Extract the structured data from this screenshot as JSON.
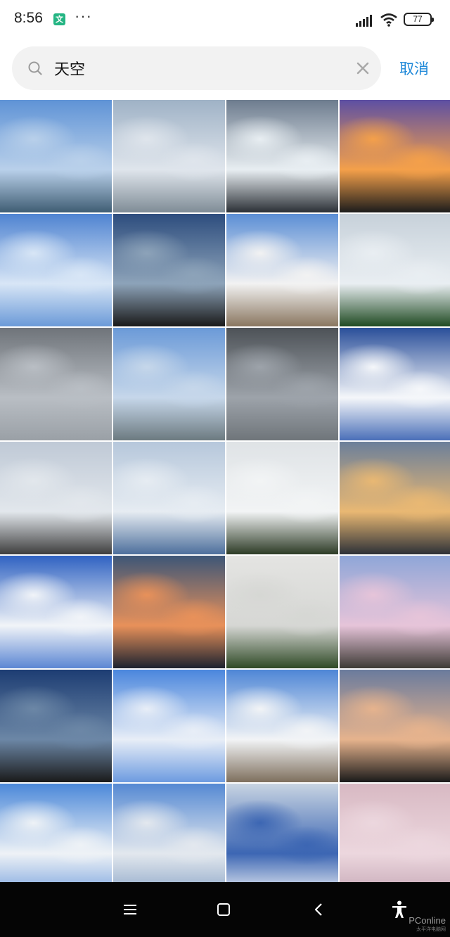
{
  "status_bar": {
    "time": "8:56",
    "app_icon": "tencent-news-icon",
    "more": "···",
    "battery": "77"
  },
  "search": {
    "query": "天空",
    "placeholder": "",
    "cancel_label": "取消"
  },
  "photos": [
    {
      "name": "photo-sky-city-blue",
      "colors": [
        "#5f93d6",
        "#b9d0ea",
        "#3f5d73"
      ]
    },
    {
      "name": "photo-grey-clouds",
      "colors": [
        "#9fb2c6",
        "#dfe5ec",
        "#7f8c96"
      ]
    },
    {
      "name": "photo-sun-through-clouds",
      "colors": [
        "#6d7c8e",
        "#e8eef2",
        "#2b3036"
      ]
    },
    {
      "name": "photo-sunset-purple",
      "colors": [
        "#5d4fa3",
        "#f4a04a",
        "#1c1c1c"
      ]
    },
    {
      "name": "photo-blue-sky-white-clouds",
      "colors": [
        "#4f83d1",
        "#d8e6f6",
        "#6b9ad8"
      ]
    },
    {
      "name": "photo-dark-river-screenshot",
      "colors": [
        "#2d4d7e",
        "#8da3b9",
        "#1a1a1a"
      ]
    },
    {
      "name": "photo-bridge-blue-sky",
      "colors": [
        "#5b8ed5",
        "#f2f2f2",
        "#8a7760"
      ]
    },
    {
      "name": "photo-palm-tree",
      "colors": [
        "#c7d1da",
        "#e9eef2",
        "#1f4a22"
      ]
    },
    {
      "name": "photo-overcast",
      "colors": [
        "#6f747a",
        "#b9bec4",
        "#9aa0a6"
      ]
    },
    {
      "name": "photo-river-horizon",
      "colors": [
        "#6b9ad8",
        "#c6d7ea",
        "#6c7a80"
      ]
    },
    {
      "name": "photo-storm-clouds-river",
      "colors": [
        "#4d5257",
        "#9da3aa",
        "#6f757a"
      ]
    },
    {
      "name": "photo-cumulus-dark-blue",
      "colors": [
        "#2a4f9a",
        "#f5f7fa",
        "#4a6fb8"
      ]
    },
    {
      "name": "photo-road-clouds",
      "colors": [
        "#bfc9d6",
        "#e2e7ec",
        "#3e3e3e"
      ]
    },
    {
      "name": "photo-wispy-clouds",
      "colors": [
        "#b6c7db",
        "#e6ecf2",
        "#4d6f9c"
      ]
    },
    {
      "name": "photo-tree-building-sky",
      "colors": [
        "#dfe3e6",
        "#f2f4f5",
        "#2d3b26"
      ]
    },
    {
      "name": "photo-golden-river-evening",
      "colors": [
        "#6b7f9a",
        "#e9b873",
        "#2d3138"
      ]
    },
    {
      "name": "photo-deep-blue-clouds",
      "colors": [
        "#2f62c2",
        "#f1f4f8",
        "#5b86d3"
      ]
    },
    {
      "name": "photo-sunset-orange-clouds",
      "colors": [
        "#3d5677",
        "#e8915a",
        "#1b2230"
      ]
    },
    {
      "name": "photo-white-sky-trees",
      "colors": [
        "#e4e4e2",
        "#d6d7d4",
        "#2f4a26"
      ]
    },
    {
      "name": "photo-buildings-pink-sky",
      "colors": [
        "#8fa6d8",
        "#e6c4d9",
        "#3d3a35"
      ]
    },
    {
      "name": "photo-dark-river-screenshot-2",
      "colors": [
        "#1d3d73",
        "#6c87a6",
        "#1a1a1a"
      ]
    },
    {
      "name": "photo-blue-sky-clouds-2",
      "colors": [
        "#4a86dd",
        "#e8eef7",
        "#6d9be0"
      ]
    },
    {
      "name": "photo-bridge-clouds-2",
      "colors": [
        "#4e86d6",
        "#f2f4f6",
        "#7e6f5d"
      ]
    },
    {
      "name": "photo-dusk-river-screenshot",
      "colors": [
        "#6a7b9d",
        "#e6b38d",
        "#1a1a1a"
      ]
    },
    {
      "name": "photo-blue-sky-clouds-3",
      "colors": [
        "#4b88d9",
        "#eef2f6",
        "#7aa3de"
      ]
    },
    {
      "name": "photo-clouds-large",
      "colors": [
        "#5589d3",
        "#e3e8ee",
        "#8da7c8"
      ]
    },
    {
      "name": "photo-sand-dune-card",
      "colors": [
        "#c8d4e2",
        "#3c66b3",
        "#eef1f5"
      ]
    },
    {
      "name": "photo-pink-clouds",
      "colors": [
        "#d8b9c3",
        "#ecd7de",
        "#c6a8b6"
      ]
    }
  ],
  "nav_bar": {
    "watermark": "PConline",
    "watermark_sub": "太平洋电脑网"
  }
}
